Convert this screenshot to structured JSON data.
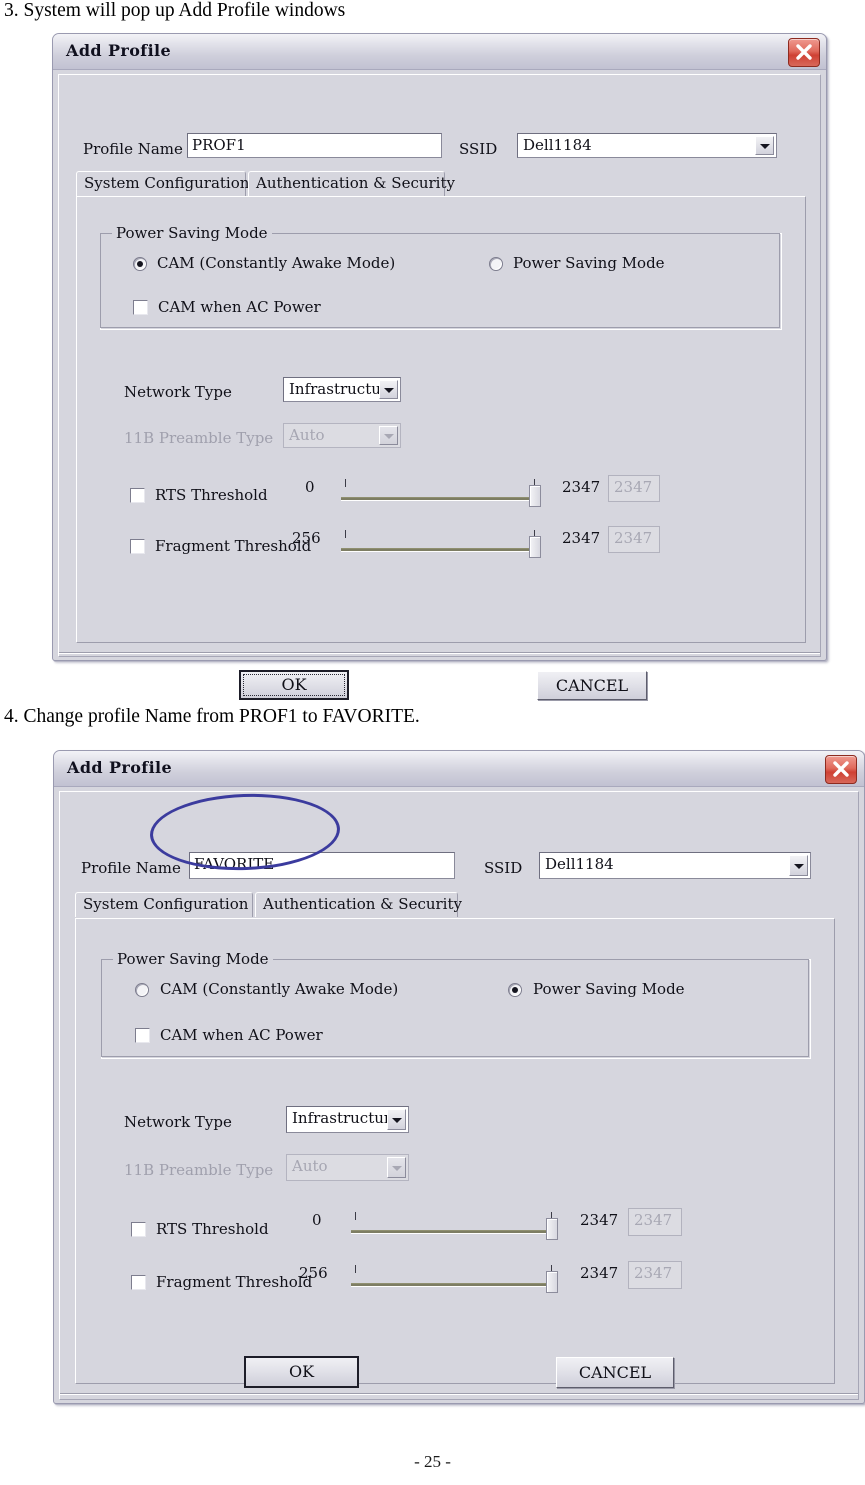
{
  "page": {
    "step3_caption": "3. System will pop up Add Profile windows",
    "step4_caption": "4. Change profile Name from PROF1 to FAVORITE.",
    "page_number": "- 25 -",
    "accent_blue": "#3b3b9e",
    "close_button_red": "#cf4134",
    "dialog_face": "#d6d6de"
  },
  "dialog1": {
    "title": "Add Profile",
    "close_icon": "close-x-icon",
    "profile_name_label": "Profile Name",
    "profile_name_value": "PROF1",
    "ssid_label": "SSID",
    "ssid_value": "Dell1184",
    "tabs": [
      {
        "label": "System Configuration",
        "selected": true
      },
      {
        "label": "Authentication & Security",
        "selected": false
      }
    ],
    "power_group_title": "Power Saving Mode",
    "radio_cam_label": "CAM (Constantly Awake Mode)",
    "radio_cam_selected": true,
    "radio_psm_label": "Power Saving Mode",
    "radio_psm_selected": false,
    "checkbox_cam_ac_label": "CAM when AC Power",
    "checkbox_cam_ac_checked": false,
    "network_type_label": "Network Type",
    "network_type_value": "Infrastructure",
    "preamble_label": "11B Preamble Type",
    "preamble_value": "Auto",
    "preamble_disabled": true,
    "rts_checkbox_checked": false,
    "rts_label": "RTS Threshold",
    "rts_min": "0",
    "rts_max": "2347",
    "rts_value": "2347",
    "frag_checkbox_checked": false,
    "frag_label": "Fragment Threshold",
    "frag_min": "256",
    "frag_max": "2347",
    "frag_value": "2347",
    "ok_label": "OK",
    "cancel_label": "CANCEL",
    "ok_is_default": true
  },
  "dialog2": {
    "title": "Add Profile",
    "close_icon": "close-x-icon",
    "profile_name_label": "Profile Name",
    "profile_name_value": "FAVORITE",
    "ssid_label": "SSID",
    "ssid_value": "Dell1184",
    "tabs": [
      {
        "label": "System Configuration",
        "selected": true
      },
      {
        "label": "Authentication & Security",
        "selected": false
      }
    ],
    "power_group_title": "Power Saving Mode",
    "radio_cam_label": "CAM (Constantly Awake Mode)",
    "radio_cam_selected": false,
    "radio_psm_label": "Power Saving Mode",
    "radio_psm_selected": true,
    "checkbox_cam_ac_label": "CAM when AC Power",
    "checkbox_cam_ac_checked": false,
    "network_type_label": "Network Type",
    "network_type_value": "Infrastructure",
    "preamble_label": "11B Preamble Type",
    "preamble_value": "Auto",
    "preamble_disabled": true,
    "rts_checkbox_checked": false,
    "rts_label": "RTS Threshold",
    "rts_min": "0",
    "rts_max": "2347",
    "rts_value": "2347",
    "frag_checkbox_checked": false,
    "frag_label": "Fragment Threshold",
    "frag_min": "256",
    "frag_max": "2347",
    "frag_value": "2347",
    "ok_label": "OK",
    "cancel_label": "CANCEL",
    "ok_is_default": false,
    "annotation": "highlight-ellipse-profile-name"
  }
}
